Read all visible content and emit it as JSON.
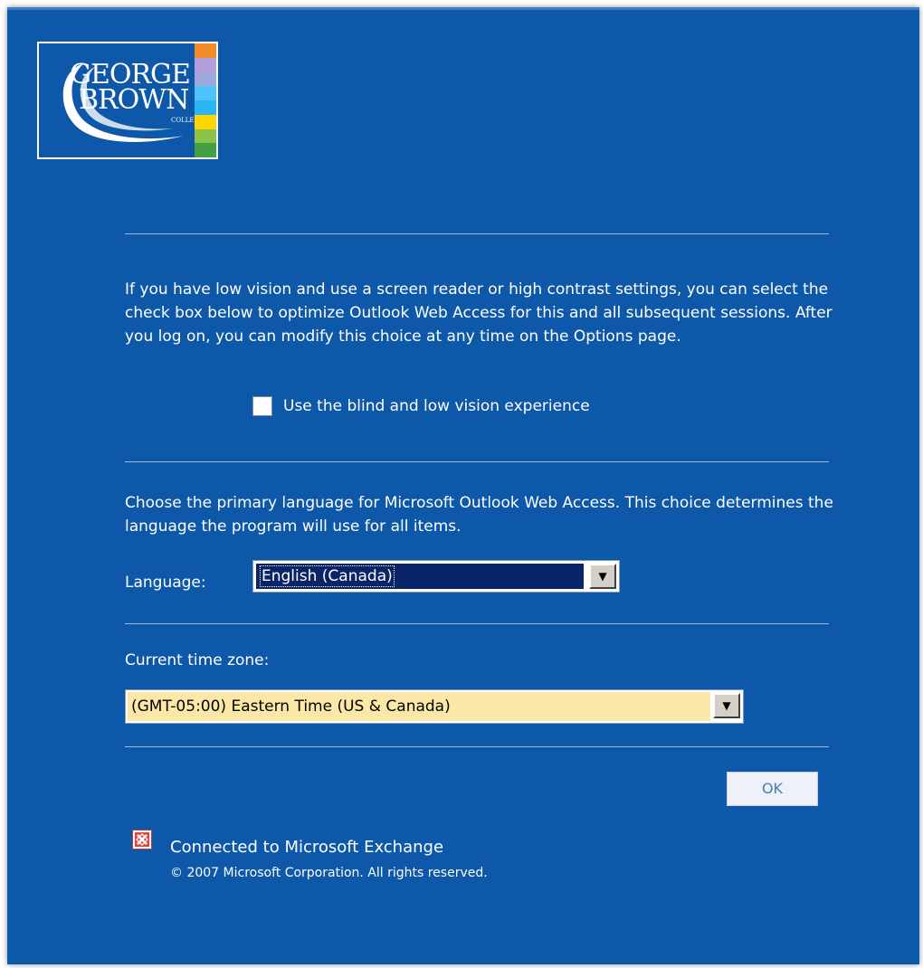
{
  "logo": {
    "line1": "GEORGE",
    "line2": "BROWN",
    "line3": "COLLEGE",
    "stripe_colors": [
      "#f28c28",
      "#b39ddb",
      "#9fa8da",
      "#4fc3f7",
      "#29b6f6",
      "#ffd600",
      "#8bc34a",
      "#43a047"
    ]
  },
  "intro_text": "If you have low vision and use a screen reader or high contrast settings, you can select the check box below to optimize Outlook Web Access for this and all subsequent sessions. After you log on, you can modify this choice at any time on the Options page.",
  "accessibility_checkbox": {
    "label": "Use the blind and low vision experience",
    "checked": false
  },
  "language_section": {
    "description": "Choose the primary language for Microsoft Outlook Web Access. This choice determines the language the program will use for all items.",
    "label": "Language:",
    "selected": "English (Canada)"
  },
  "timezone_section": {
    "label": "Current time zone:",
    "selected": "(GMT-05:00) Eastern Time (US & Canada)"
  },
  "ok_button": {
    "label": "OK"
  },
  "footer": {
    "connected_text": "Connected to Microsoft Exchange",
    "copyright": "© 2007 Microsoft Corporation. All rights reserved."
  },
  "colors": {
    "background": "#0d58a8",
    "selection": "#0a246a",
    "timezone_fill": "#fbe8a6"
  }
}
